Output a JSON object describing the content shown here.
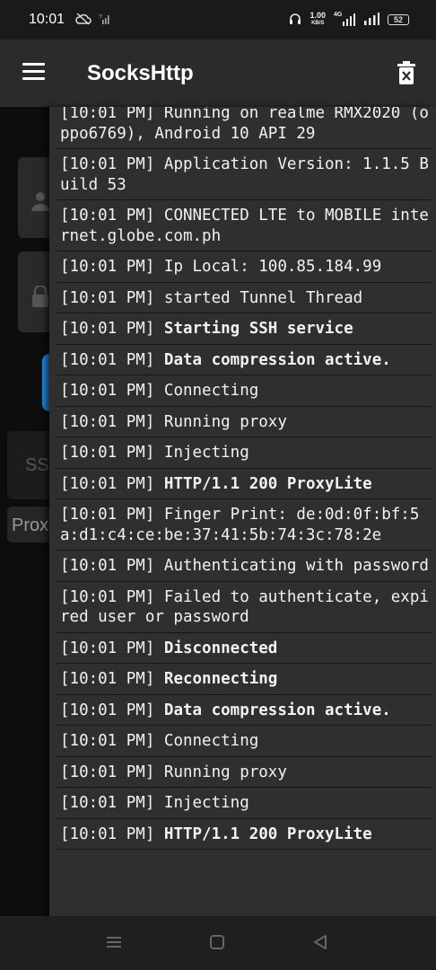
{
  "status_bar": {
    "time": "10:01",
    "speed_value": "1.00",
    "speed_unit": "KB/S",
    "network": "4G",
    "battery": "52"
  },
  "app_bar": {
    "title": "SocksHttp",
    "menu_icon": "hamburger-menu-icon",
    "delete_icon": "trash-icon"
  },
  "background": {
    "ssh_label": "SS",
    "proxy_label": "Prox"
  },
  "log": {
    "entries": [
      {
        "prefix": "[10:01 PM]",
        "text": "Running on realme RMX2020 (oppo6769), Android 10 API 29",
        "bold": false
      },
      {
        "prefix": "[10:01 PM]",
        "text": "Application Version: 1.1.5 Build 53",
        "bold": false
      },
      {
        "prefix": "[10:01 PM]",
        "text": "CONNECTED LTE to MOBILE internet.globe.com.ph",
        "bold": false
      },
      {
        "prefix": "[10:01 PM]",
        "text": "Ip Local: 100.85.184.99",
        "bold": false
      },
      {
        "prefix": "[10:01 PM]",
        "text": "started Tunnel Thread",
        "bold": false
      },
      {
        "prefix": "[10:01 PM]",
        "text": "Starting SSH service",
        "bold": true
      },
      {
        "prefix": "[10:01 PM]",
        "text": "Data compression active.",
        "bold": true
      },
      {
        "prefix": "[10:01 PM]",
        "text": "Connecting",
        "bold": false
      },
      {
        "prefix": "[10:01 PM]",
        "text": "Running proxy",
        "bold": false
      },
      {
        "prefix": "[10:01 PM]",
        "text": "Injecting",
        "bold": false
      },
      {
        "prefix": "[10:01 PM]",
        "text": "HTTP/1.1 200 ProxyLite",
        "bold": true
      },
      {
        "prefix": "[10:01 PM]",
        "text": "Finger Print: de:0d:0f:bf:5a:d1:c4:ce:be:37:41:5b:74:3c:78:2e",
        "bold": false
      },
      {
        "prefix": "[10:01 PM]",
        "text": "Authenticating with password",
        "bold": false
      },
      {
        "prefix": "[10:01 PM]",
        "text": "Failed to authenticate, expired user or password",
        "bold": false
      },
      {
        "prefix": "[10:01 PM]",
        "text": "Disconnected",
        "bold": true
      },
      {
        "prefix": "[10:01 PM]",
        "text": "Reconnecting",
        "bold": true
      },
      {
        "prefix": "[10:01 PM]",
        "text": "Data compression active.",
        "bold": true
      },
      {
        "prefix": "[10:01 PM]",
        "text": "Connecting",
        "bold": false
      },
      {
        "prefix": "[10:01 PM]",
        "text": "Running proxy",
        "bold": false
      },
      {
        "prefix": "[10:01 PM]",
        "text": "Injecting",
        "bold": false
      },
      {
        "prefix": "[10:01 PM]",
        "text": "HTTP/1.1 200 ProxyLite",
        "bold": true
      }
    ]
  },
  "nav_bar": {
    "recents_icon": "recents-icon",
    "home_icon": "home-icon",
    "back_icon": "back-icon"
  },
  "colors": {
    "app_bar_bg": "#2b2b2b",
    "log_bg": "#2f2f2f",
    "accent_blue": "#1e88e5"
  }
}
